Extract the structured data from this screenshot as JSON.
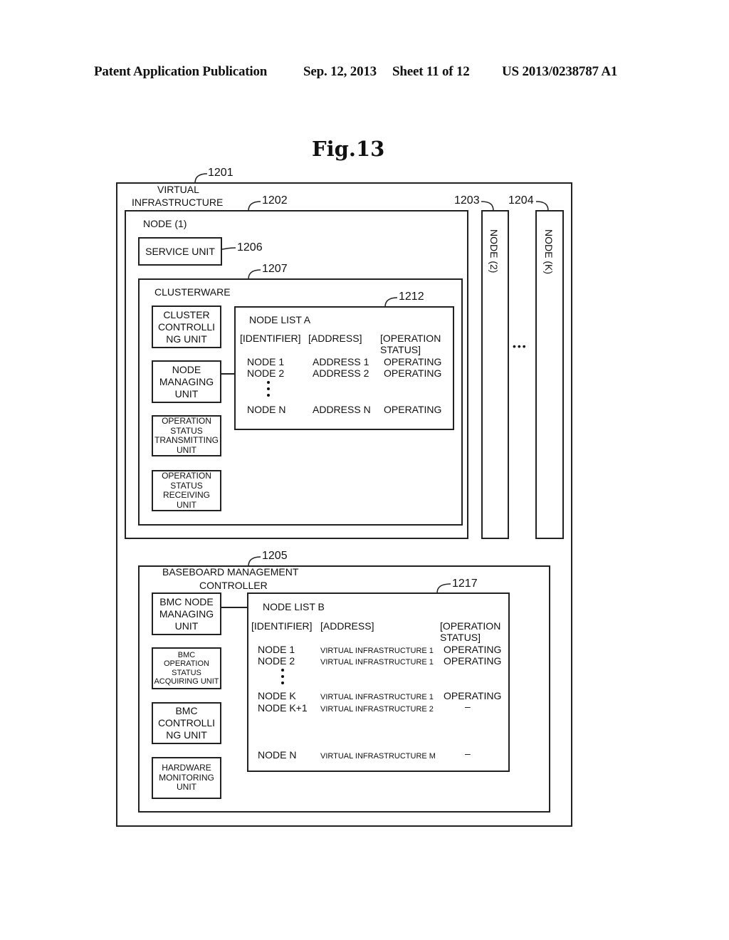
{
  "header": {
    "publication": "Patent Application Publication",
    "date": "Sep. 12, 2013",
    "sheet": "Sheet 11 of 12",
    "number": "US 2013/0238787 A1"
  },
  "figure": {
    "title": "Fig.13"
  },
  "refs": {
    "r1201": "1201",
    "r1202": "1202",
    "r1203": "1203",
    "r1204": "1204",
    "r1205": "1205",
    "r1206": "1206",
    "r1207": "1207",
    "r1212": "1212",
    "r1217": "1217"
  },
  "virtual_infrastructure": {
    "label_line1": "VIRTUAL",
    "label_line2": "INFRASTRUCTURE",
    "node1": {
      "label": "NODE (1)",
      "service_unit": "SERVICE UNIT",
      "clusterware": {
        "label": "CLUSTERWARE",
        "units": [
          {
            "lines": [
              "CLUSTER",
              "CONTROLLI",
              "NG UNIT"
            ]
          },
          {
            "lines": [
              "NODE",
              "MANAGING",
              "UNIT"
            ]
          },
          {
            "lines": [
              "OPERATION",
              "STATUS",
              "TRANSMITTING",
              "UNIT"
            ]
          },
          {
            "lines": [
              "OPERATION",
              "STATUS",
              "RECEIVING",
              "UNIT"
            ]
          }
        ],
        "node_list_a": {
          "title": "NODE LIST A",
          "headers": [
            "[IDENTIFIER]",
            "[ADDRESS]",
            "[OPERATION",
            "STATUS]"
          ],
          "rows": [
            {
              "id": "NODE 1",
              "address": "ADDRESS 1",
              "status": "OPERATING"
            },
            {
              "id": "NODE 2",
              "address": "ADDRESS 2",
              "status": "OPERATING"
            },
            {
              "id": "NODE N",
              "address": "ADDRESS N",
              "status": "OPERATING"
            }
          ]
        }
      }
    },
    "node2": {
      "label": "NODE (2)"
    },
    "nodeK": {
      "label": "NODE (K)"
    },
    "ellipsis": "•••",
    "bmc": {
      "label_line1": "BASEBOARD MANAGEMENT",
      "label_line2": "CONTROLLER",
      "units": [
        {
          "lines": [
            "BMC NODE",
            "MANAGING",
            "UNIT"
          ]
        },
        {
          "lines": [
            "BMC",
            "OPERATION",
            "STATUS",
            "ACQUIRING UNIT"
          ]
        },
        {
          "lines": [
            "BMC",
            "CONTROLLI",
            "NG UNIT"
          ]
        },
        {
          "lines": [
            "HARDWARE",
            "MONITORING",
            "UNIT"
          ]
        }
      ],
      "node_list_b": {
        "title": "NODE LIST B",
        "headers": [
          "[IDENTIFIER]",
          "[ADDRESS]",
          "[OPERATION",
          "STATUS]"
        ],
        "rows": [
          {
            "id": "NODE 1",
            "address": "VIRTUAL INFRASTRUCTURE 1",
            "status": "OPERATING"
          },
          {
            "id": "NODE 2",
            "address": "VIRTUAL INFRASTRUCTURE 1",
            "status": "OPERATING"
          },
          {
            "id": "NODE K",
            "address": "VIRTUAL INFRASTRUCTURE 1",
            "status": "OPERATING"
          },
          {
            "id": "NODE K+1",
            "address": "VIRTUAL INFRASTRUCTURE 2",
            "status": "–"
          },
          {
            "id": "NODE N",
            "address": "VIRTUAL INFRASTRUCTURE M",
            "status": "–"
          }
        ]
      }
    }
  }
}
